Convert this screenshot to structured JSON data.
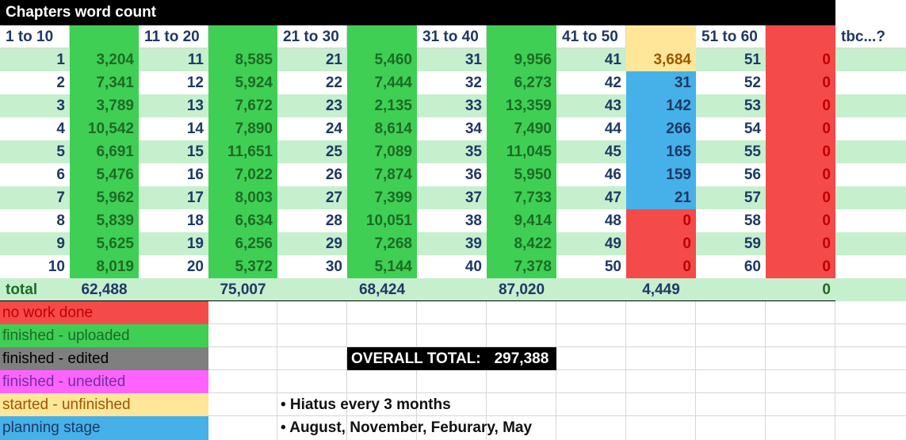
{
  "title": "Chapters  word count",
  "headers": [
    "1 to 10",
    "11 to 20",
    "21 to 30",
    "31 to 40",
    "41 to 50",
    "51 to 60",
    "tbc...?"
  ],
  "groups": [
    {
      "chapters": [
        "1",
        "2",
        "3",
        "4",
        "5",
        "6",
        "7",
        "8",
        "9",
        "10"
      ],
      "counts": [
        "3,204",
        "7,341",
        "3,789",
        "10,542",
        "6,691",
        "5,476",
        "5,962",
        "5,839",
        "5,625",
        "8,019"
      ],
      "statuses": [
        "uploaded",
        "uploaded",
        "uploaded",
        "uploaded",
        "uploaded",
        "uploaded",
        "uploaded",
        "uploaded",
        "uploaded",
        "uploaded"
      ],
      "total": "62,488"
    },
    {
      "chapters": [
        "11",
        "12",
        "13",
        "14",
        "15",
        "16",
        "17",
        "18",
        "19",
        "20"
      ],
      "counts": [
        "8,585",
        "5,924",
        "7,672",
        "7,890",
        "11,651",
        "7,022",
        "8,003",
        "6,634",
        "6,256",
        "5,372"
      ],
      "statuses": [
        "uploaded",
        "uploaded",
        "uploaded",
        "uploaded",
        "uploaded",
        "uploaded",
        "uploaded",
        "uploaded",
        "uploaded",
        "uploaded"
      ],
      "total": "75,007"
    },
    {
      "chapters": [
        "21",
        "22",
        "23",
        "24",
        "25",
        "26",
        "27",
        "28",
        "29",
        "30"
      ],
      "counts": [
        "5,460",
        "7,444",
        "2,135",
        "8,614",
        "7,089",
        "7,874",
        "7,399",
        "10,051",
        "7,268",
        "5,144"
      ],
      "statuses": [
        "uploaded",
        "uploaded",
        "uploaded",
        "uploaded",
        "uploaded",
        "uploaded",
        "uploaded",
        "uploaded",
        "uploaded",
        "uploaded"
      ],
      "total": "68,424"
    },
    {
      "chapters": [
        "31",
        "32",
        "33",
        "34",
        "35",
        "36",
        "37",
        "38",
        "39",
        "40"
      ],
      "counts": [
        "9,956",
        "6,273",
        "13,359",
        "7,490",
        "11,045",
        "5,950",
        "7,733",
        "9,414",
        "8,422",
        "7,378"
      ],
      "statuses": [
        "uploaded",
        "uploaded",
        "uploaded",
        "uploaded",
        "uploaded",
        "uploaded",
        "uploaded",
        "uploaded",
        "uploaded",
        "uploaded"
      ],
      "total": "87,020"
    },
    {
      "chapters": [
        "41",
        "42",
        "43",
        "44",
        "45",
        "46",
        "47",
        "48",
        "49",
        "50"
      ],
      "counts": [
        "3,684",
        "31",
        "142",
        "266",
        "165",
        "159",
        "21",
        "0",
        "0",
        "0"
      ],
      "statuses": [
        "started",
        "planning",
        "planning",
        "planning",
        "planning",
        "planning",
        "planning",
        "none",
        "none",
        "none"
      ],
      "total": "4,449"
    },
    {
      "chapters": [
        "51",
        "52",
        "53",
        "54",
        "55",
        "56",
        "57",
        "58",
        "59",
        "60"
      ],
      "counts": [
        "0",
        "0",
        "0",
        "0",
        "0",
        "0",
        "0",
        "0",
        "0",
        "0"
      ],
      "statuses": [
        "none",
        "none",
        "none",
        "none",
        "none",
        "none",
        "none",
        "none",
        "none",
        "none"
      ],
      "total": "0"
    }
  ],
  "total_label": "total",
  "legend": [
    {
      "key": "none",
      "label": "no work done",
      "bg": "#f44a4a",
      "fg": "#c00000"
    },
    {
      "key": "uploaded",
      "label": "finished - uploaded",
      "bg": "#3fcf55",
      "fg": "#1e6b24"
    },
    {
      "key": "edited",
      "label": "finished - edited",
      "bg": "#7f7f7f",
      "fg": "#000000"
    },
    {
      "key": "unedited",
      "label": "finished - unedited",
      "bg": "#ff63ff",
      "fg": "#7030a0"
    },
    {
      "key": "started",
      "label": "started - unfinished",
      "bg": "#ffe699",
      "fg": "#9c5700"
    },
    {
      "key": "planning",
      "label": "planning stage",
      "bg": "#45b1e8",
      "fg": "#1f3864"
    }
  ],
  "overall_label": "OVERALL TOTAL:",
  "overall_value": "297,388",
  "notes": [
    "• Hiatus every 3 months",
    "• August, November, Feburary, May"
  ],
  "colors": {
    "band": "#c6efce",
    "title_bg": "#000000",
    "title_fg": "#ffffff",
    "header_green": "#3fcf55",
    "header_yellow": "#ffe699",
    "header_red": "#f44a4a",
    "text_green": "#1e6b24",
    "text_blue": "#1f3864",
    "text_started": "#9c5700",
    "text_zero": "#c00000"
  }
}
